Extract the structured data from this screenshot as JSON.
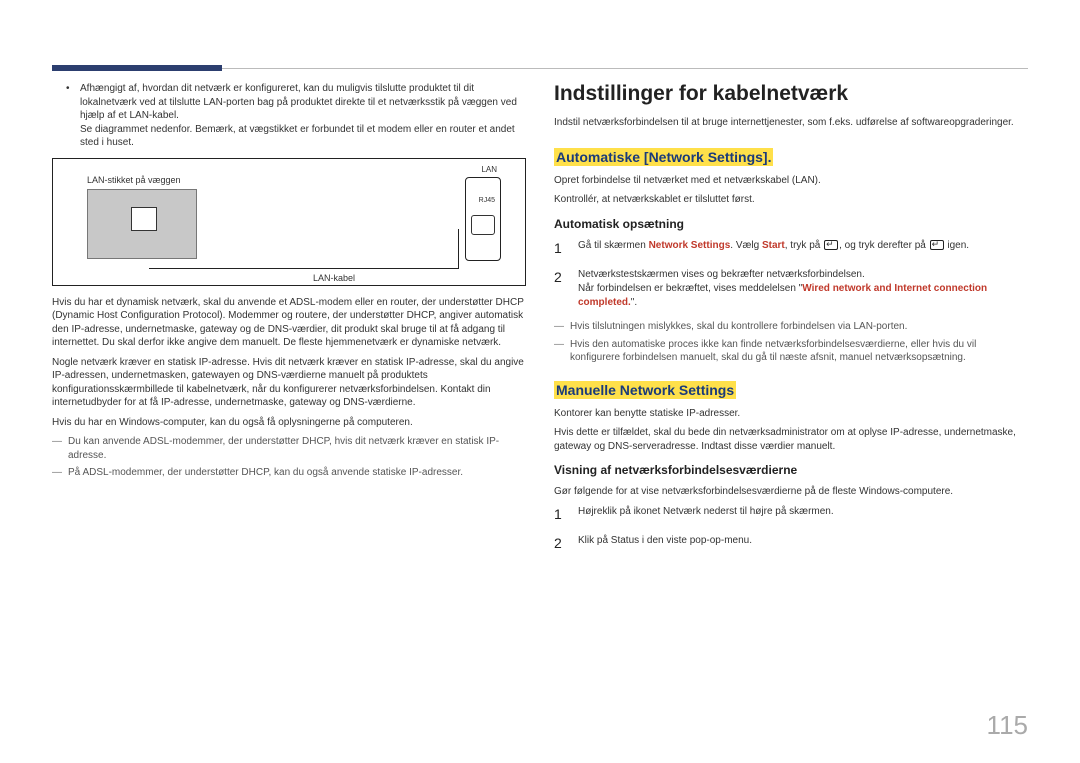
{
  "left": {
    "bullet1": "Afhængigt af, hvordan dit netværk er konfigureret, kan du muligvis tilslutte produktet til dit lokalnetværk ved at tilslutte LAN-porten bag på produktet direkte til et netværksstik på væggen ved hjælp af et LAN-kabel.",
    "bullet1b": "Se diagrammet nedenfor. Bemærk, at vægstikket er forbundet til et modem eller en router et andet sted i huset.",
    "diagram": {
      "wall_label": "LAN-stikket på væggen",
      "cable_label": "LAN-kabel",
      "lan_label": "LAN",
      "rj45_label": "RJ45"
    },
    "p1": "Hvis du har et dynamisk netværk, skal du anvende et ADSL-modem eller en router, der understøtter DHCP (Dynamic Host Configuration Protocol). Modemmer og routere, der understøtter DHCP, angiver automatisk den IP-adresse, undernetmaske, gateway og de DNS-værdier, dit produkt skal bruge til at få adgang til internettet. Du skal derfor ikke angive dem manuelt. De fleste hjemmenetværk er dynamiske netværk.",
    "p2": "Nogle netværk kræver en statisk IP-adresse. Hvis dit netværk kræver en statisk IP-adresse, skal du angive IP-adressen, undernetmasken, gatewayen og DNS-værdierne manuelt på produktets konfigurationsskærmbillede til kabelnetværk, når du konfigurerer netværksforbindelsen. Kontakt din internetudbyder for at få IP-adresse, undernetmaske, gateway og DNS-værdierne.",
    "p3": "Hvis du har en Windows-computer, kan du også få oplysningerne på computeren.",
    "dash1": "Du kan anvende ADSL-modemmer, der understøtter DHCP, hvis dit netværk kræver en statisk IP-adresse.",
    "dash2": "På ADSL-modemmer, der understøtter DHCP, kan du også anvende statiske IP-adresser."
  },
  "right": {
    "h1": "Indstillinger for kabelnetværk",
    "intro": "Indstil netværksforbindelsen til at bruge internettjenester, som f.eks. udførelse af softwareopgraderinger.",
    "sec1_title": "Automatiske [Network Settings].",
    "sec1_p1": "Opret forbindelse til netværket med et netværkskabel (LAN).",
    "sec1_p2": "Kontrollér, at netværkskablet er tilsluttet først.",
    "sec1_sub": "Automatisk opsætning",
    "step1_a": "Gå til skærmen ",
    "step1_red1": "Network Settings",
    "step1_b": ". Vælg ",
    "step1_red2": "Start",
    "step1_c": ", tryk på ",
    "step1_d": ", og tryk derefter på ",
    "step1_e": " igen.",
    "step2": "Netværkstestskærmen vises og bekræfter netværksforbindelsen.",
    "step_note_a": "Når forbindelsen er bekræftet, vises meddelelsen \"",
    "step_note_red": "Wired network and Internet connection completed.",
    "step_note_b": "\".",
    "dash1": "Hvis tilslutningen mislykkes, skal du kontrollere forbindelsen via LAN-porten.",
    "dash2": "Hvis den automatiske proces ikke kan finde netværksforbindelsesværdierne, eller hvis du vil konfigurere forbindelsen manuelt, skal du gå til næste afsnit, manuel netværksopsætning.",
    "sec2_title": "Manuelle Network Settings",
    "sec2_p1": "Kontorer kan benytte statiske IP-adresser.",
    "sec2_p2": "Hvis dette er tilfældet, skal du bede din netværksadministrator om at oplyse IP-adresse, undernetmaske, gateway og DNS-serveradresse. Indtast disse værdier manuelt.",
    "sec2_sub": "Visning af netværksforbindelsesværdierne",
    "sec2_p3": "Gør følgende for at vise netværksforbindelsesværdierne på de fleste Windows-computere.",
    "sec2_step1": "Højreklik på ikonet Netværk nederst til højre på skærmen.",
    "sec2_step2": "Klik på Status i den viste pop-op-menu."
  },
  "page_number": "115"
}
